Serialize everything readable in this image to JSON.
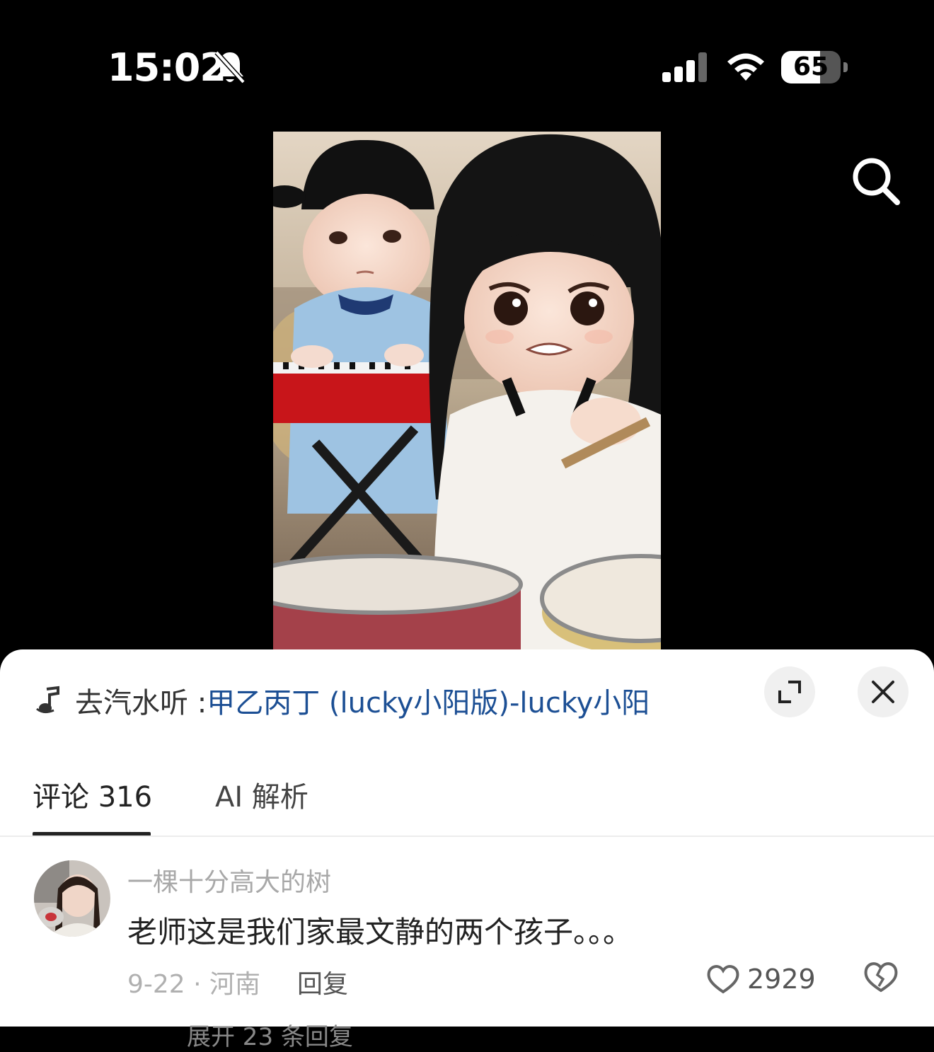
{
  "status_bar": {
    "time": "15:02",
    "battery_level": "65",
    "icons": [
      "mute-bell-icon",
      "cellular-signal-icon",
      "wifi-icon",
      "battery-icon"
    ]
  },
  "header": {
    "icons": [
      "search-icon"
    ]
  },
  "video": {
    "description_icons": [
      "video-frame"
    ]
  },
  "music": {
    "prefix": "去汽水听 : ",
    "track": "甲乙丙丁 (lucky小阳版)-lucky小阳",
    "icons": [
      "music-note-icon",
      "expand-icon",
      "close-icon"
    ]
  },
  "tabs": [
    {
      "label": "评论 316",
      "active": true
    },
    {
      "label": "AI 解析",
      "active": false
    }
  ],
  "comment": {
    "user": "一棵十分高大的树",
    "text": "老师这是我们家最文静的两个孩子。。。",
    "meta": "9-22 · 河南",
    "reply_label": "回复",
    "likes": "2929"
  },
  "more_replies": "展开 23 条回复",
  "colors": {
    "link": "#1c4f94",
    "sheet_bg": "#ffffff",
    "background": "#000000"
  }
}
